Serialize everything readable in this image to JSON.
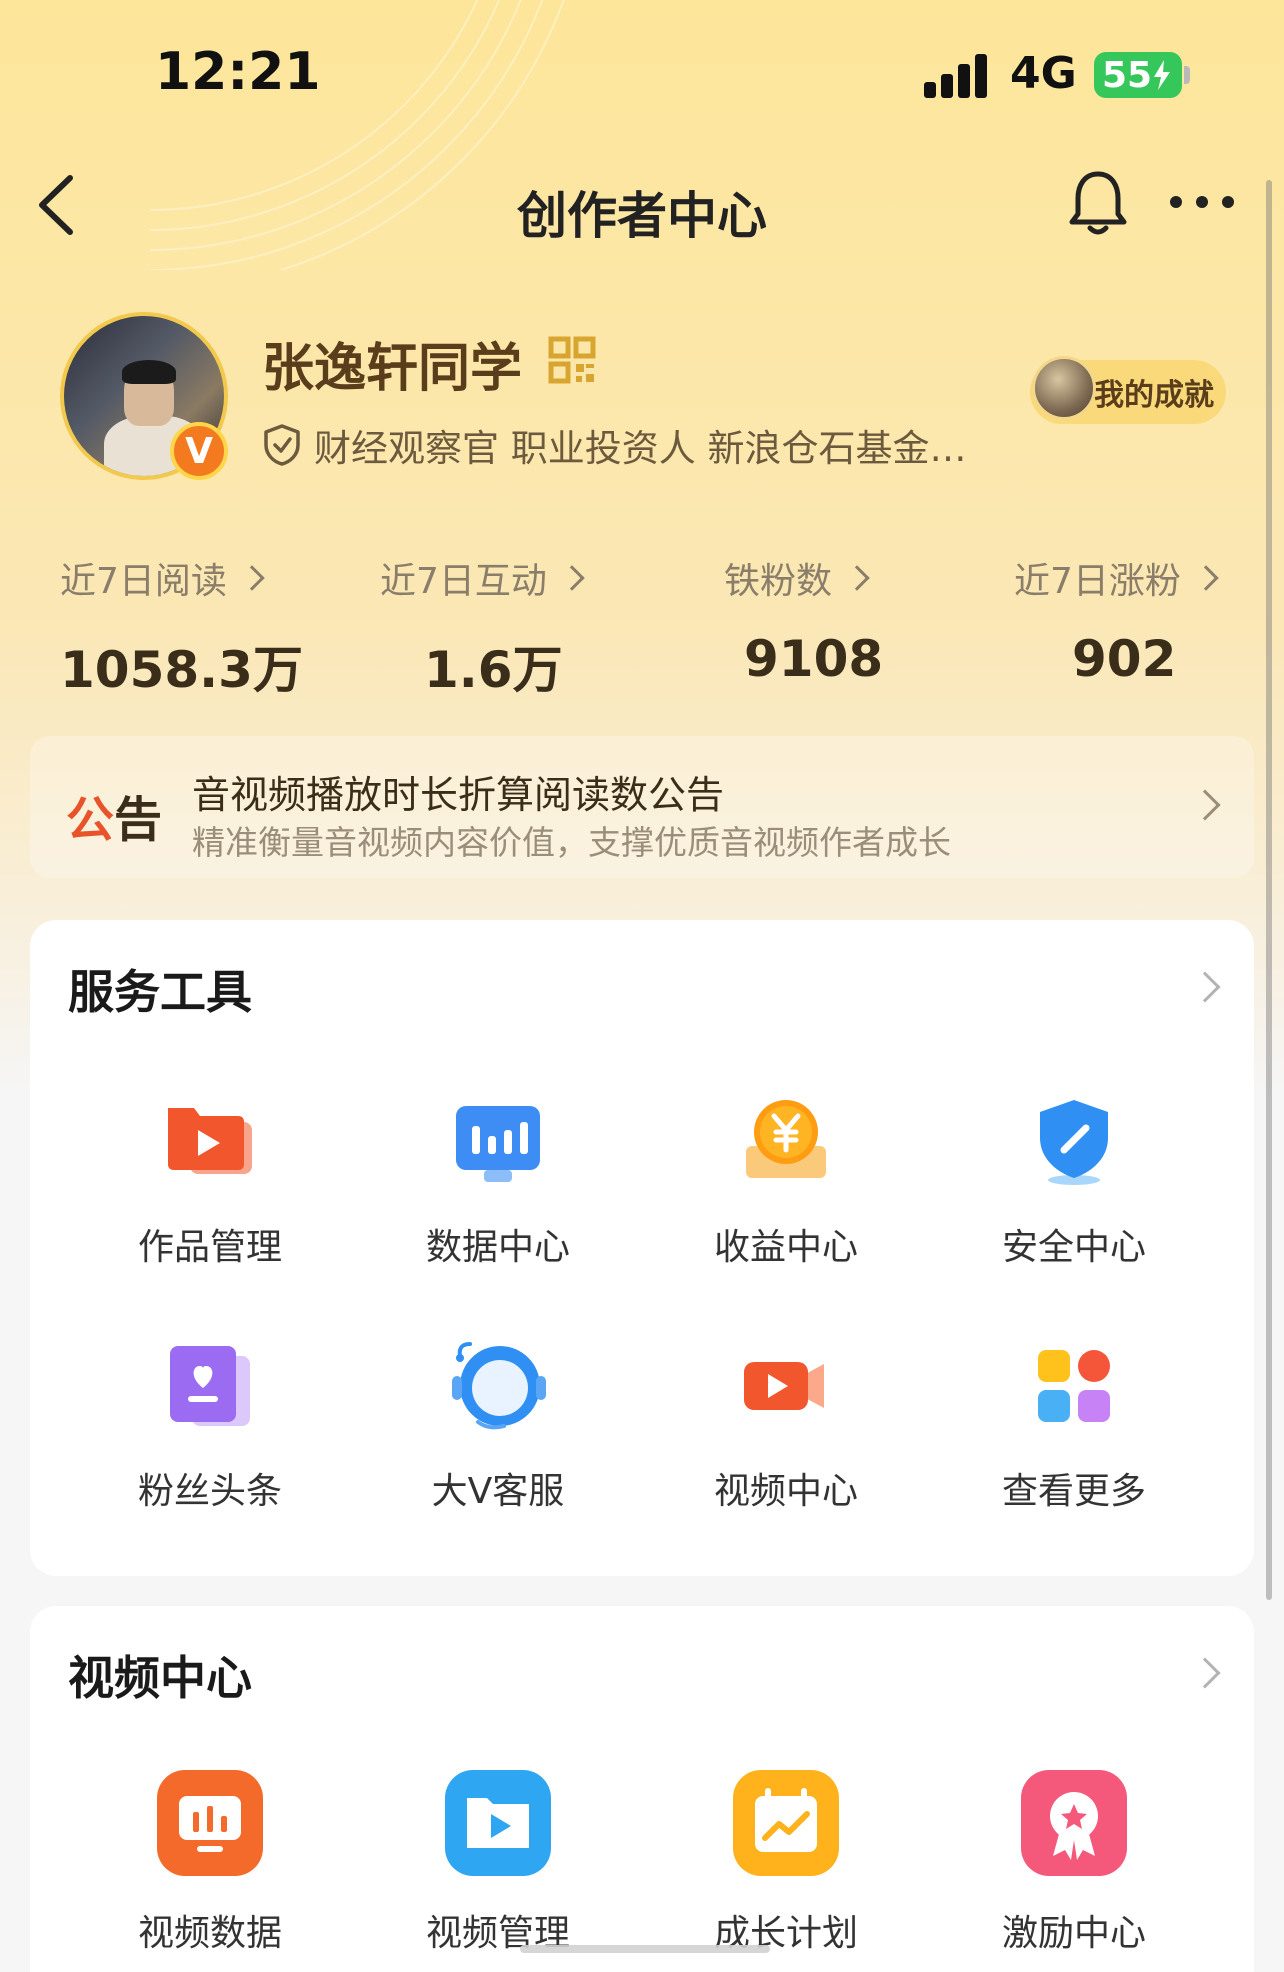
{
  "status_bar": {
    "time": "12:21",
    "network": "4G",
    "battery": "55"
  },
  "nav": {
    "title": "创作者中心"
  },
  "profile": {
    "name": "张逸轩同学",
    "verify_text": "财经观察官 职业投资人 新浪仓石基金…",
    "vip_badge": "V",
    "achievement_label": "我的成就"
  },
  "stats": [
    {
      "label": "近7日阅读",
      "value": "1058.3万"
    },
    {
      "label": "近7日互动",
      "value": "1.6万"
    },
    {
      "label": "铁粉数",
      "value": "9108"
    },
    {
      "label": "近7日涨粉",
      "value": "902"
    }
  ],
  "announcement": {
    "tag_part1": "公",
    "tag_part2": "告",
    "title": "音视频播放时长折算阅读数公告",
    "subtitle": "精准衡量音视频内容价值，支撑优质音视频作者成长"
  },
  "service_tools": {
    "title": "服务工具",
    "items": [
      {
        "label": "作品管理",
        "icon": "works-manage-icon"
      },
      {
        "label": "数据中心",
        "icon": "data-center-icon"
      },
      {
        "label": "收益中心",
        "icon": "income-center-icon"
      },
      {
        "label": "安全中心",
        "icon": "security-center-icon"
      },
      {
        "label": "粉丝头条",
        "icon": "fans-headline-icon"
      },
      {
        "label": "大V客服",
        "icon": "customer-service-icon"
      },
      {
        "label": "视频中心",
        "icon": "video-center-icon"
      },
      {
        "label": "查看更多",
        "icon": "more-apps-icon"
      }
    ]
  },
  "video_center": {
    "title": "视频中心",
    "items": [
      {
        "label": "视频数据",
        "icon": "video-data-icon"
      },
      {
        "label": "视频管理",
        "icon": "video-manage-icon"
      },
      {
        "label": "成长计划",
        "icon": "growth-plan-icon"
      },
      {
        "label": "激励中心",
        "icon": "incentive-center-icon"
      }
    ]
  },
  "colors": {
    "header_gradient_top": "#fde69a",
    "accent_orange": "#f47a1f",
    "notice_red": "#e8532a",
    "battery_green": "#35c759"
  }
}
